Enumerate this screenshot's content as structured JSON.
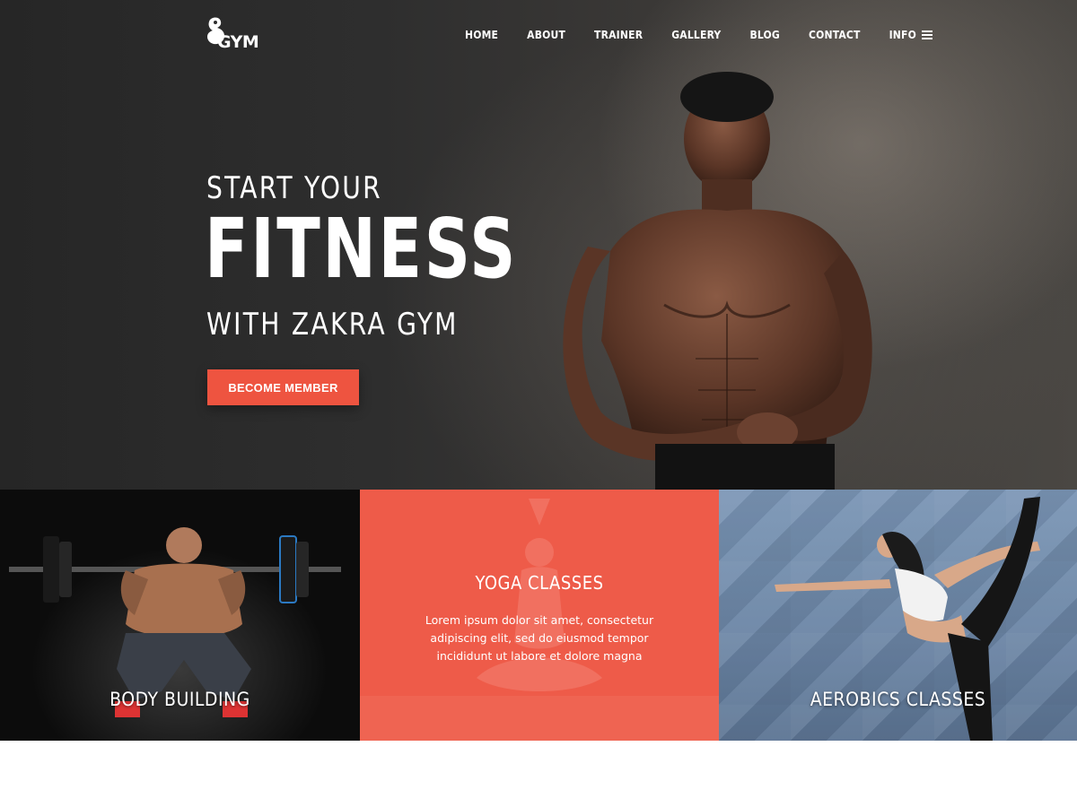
{
  "logo": {
    "text": "GYM",
    "icon": "flexed-arm-icon"
  },
  "nav": {
    "items": [
      "HOME",
      "ABOUT",
      "TRAINER",
      "GALLERY",
      "BLOG",
      "CONTACT",
      "INFO"
    ],
    "menu_icon": "hamburger-icon"
  },
  "hero": {
    "line1": "START YOUR",
    "line2": "FITNESS",
    "line3": "WITH ZAKRA GYM",
    "cta_label": "BECOME MEMBER"
  },
  "features": {
    "body_building": {
      "title": "BODY BUILDING"
    },
    "yoga": {
      "title": "YOGA CLASSES",
      "description": "Lorem ipsum dolor sit amet, consectetur adipiscing elit, sed do eiusmod tempor incididunt ut labore et dolore magna"
    },
    "aerobics": {
      "title": "AEROBICS CLASSES"
    }
  },
  "colors": {
    "accent": "#ee5440",
    "yoga_panel": "#ee5b49",
    "hero_bg": "#2e2e2e",
    "aerobics_bg": "#6a84a4"
  }
}
